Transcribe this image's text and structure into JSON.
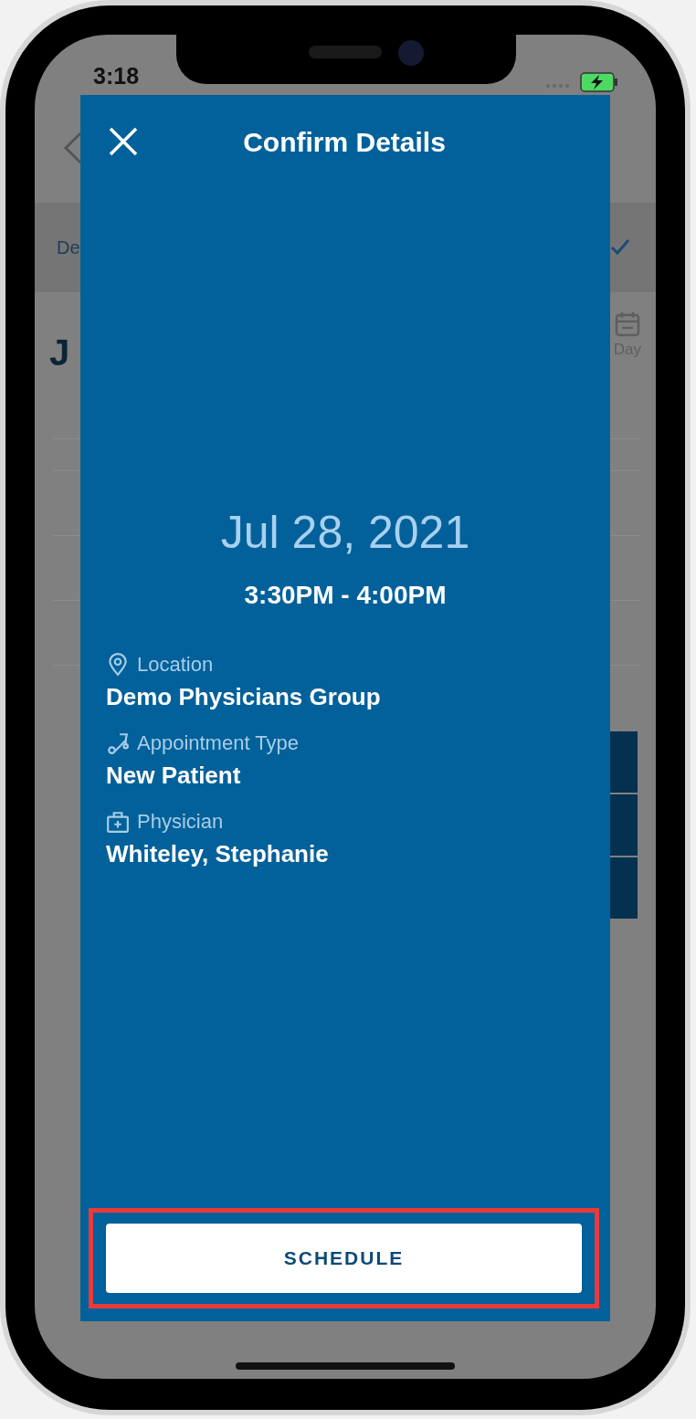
{
  "status_bar": {
    "time": "3:18"
  },
  "background": {
    "band_text": "De",
    "heading": "J",
    "view_label": "Day"
  },
  "modal": {
    "title": "Confirm Details",
    "date": "Jul 28, 2021",
    "time_range": "3:30PM - 4:00PM",
    "details": [
      {
        "kind": "location",
        "label": "Location",
        "value": "Demo Physicians Group"
      },
      {
        "kind": "stethoscope",
        "label": "Appointment Type",
        "value": "New Patient"
      },
      {
        "kind": "medkit",
        "label": "Physician",
        "value": "Whiteley, Stephanie"
      }
    ],
    "button": {
      "label": "SCHEDULE",
      "highlighted": true
    }
  }
}
